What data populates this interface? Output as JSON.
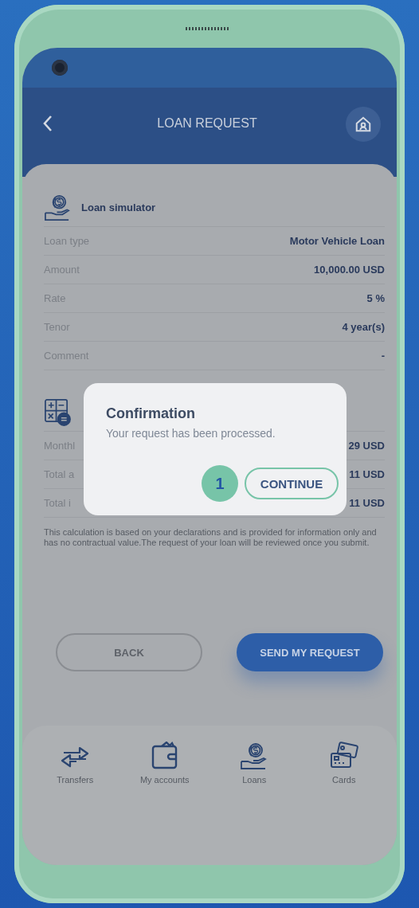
{
  "header": {
    "title": "LOAN REQUEST"
  },
  "sections": [
    {
      "title": "Loan simulator",
      "kind": "coins-hand",
      "rows": [
        {
          "label": "Loan type",
          "value": "Motor Vehicle Loan"
        },
        {
          "label": "Amount",
          "value": "10,000.00 USD"
        },
        {
          "label": "Rate",
          "value": "5 %"
        },
        {
          "label": "Tenor",
          "value": "4 year(s)"
        },
        {
          "label": "Comment",
          "value": "-"
        }
      ]
    },
    {
      "kind": "calculator",
      "rows": [
        {
          "label": "Monthl",
          "value": "29 USD"
        },
        {
          "label": "Total a",
          "value": "11 USD"
        },
        {
          "label": "Total i",
          "value": "11 USD"
        }
      ]
    }
  ],
  "disclaimer": "This calculation is based on your declarations and is provided for information only and has no contractual value.The request of your loan will be reviewed once you submit.",
  "buttons": [
    {
      "label": "BACK",
      "kind": "outline"
    },
    {
      "label": "SEND MY REQUEST",
      "kind": "primary"
    }
  ],
  "nav": [
    {
      "label": "Transfers",
      "kind": "arrows"
    },
    {
      "label": "My accounts",
      "kind": "wallet"
    },
    {
      "label": "Loans",
      "kind": "coins-hand"
    },
    {
      "label": "Cards",
      "kind": "cards"
    }
  ],
  "dialog": {
    "title": "Confirmation",
    "message": "Your request has been processed.",
    "step": "1",
    "action": "CONTINUE"
  }
}
